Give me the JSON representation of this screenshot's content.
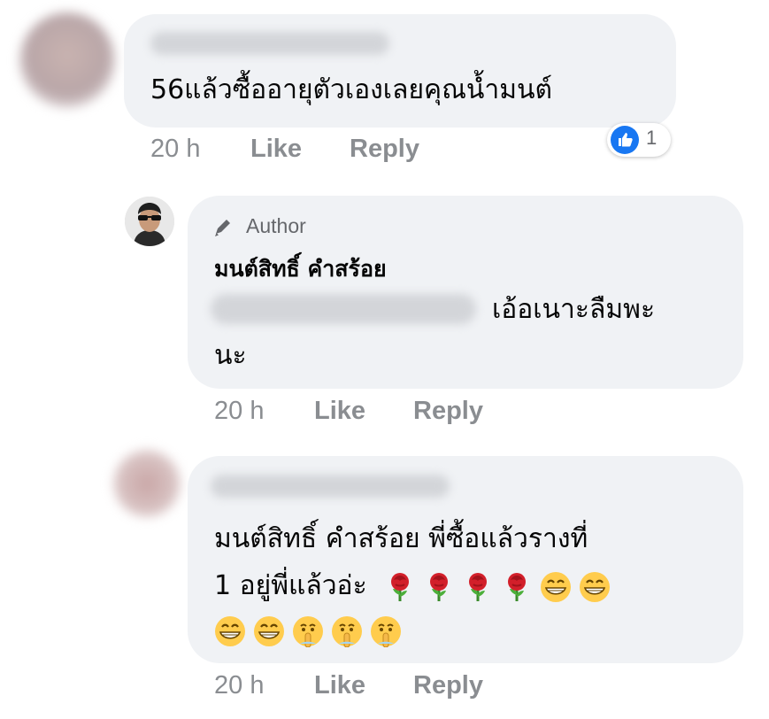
{
  "comments": [
    {
      "text": "56แล้วซื้ออายุตัวเองเลยคุณน้ำมนต์",
      "time": "20 h",
      "like": "Like",
      "reply": "Reply",
      "reaction_count": "1"
    },
    {
      "badge": "Author",
      "author": "มนต์สิทธิ์ คำสร้อย",
      "text_line1": "เอ้อเนาะลืมพะ",
      "text_line2": "นะ",
      "time": "20 h",
      "like": "Like",
      "reply": "Reply"
    },
    {
      "text_line1": "มนต์สิทธิ์ คำสร้อย   พี่ซื้อแล้วรางที่",
      "text_line2": "1   อยู่พี่แล้วอ่ะ",
      "time": "20 h",
      "like": "Like",
      "reply": "Reply"
    }
  ],
  "icons": {
    "reaction": "like-reaction-icon",
    "badge": "pencil-icon",
    "emoji_line2": [
      "rose-icon",
      "rose-icon",
      "rose-icon",
      "rose-icon",
      "grinning-face-icon",
      "grinning-face-icon"
    ],
    "emoji_line3": [
      "grinning-face-icon",
      "grinning-face-icon",
      "shushing-face-icon",
      "shushing-face-icon",
      "shushing-face-icon"
    ]
  },
  "colors": {
    "bubble": "#f0f2f5",
    "meta": "#8a8d91",
    "like_blue": "#1877f2"
  }
}
